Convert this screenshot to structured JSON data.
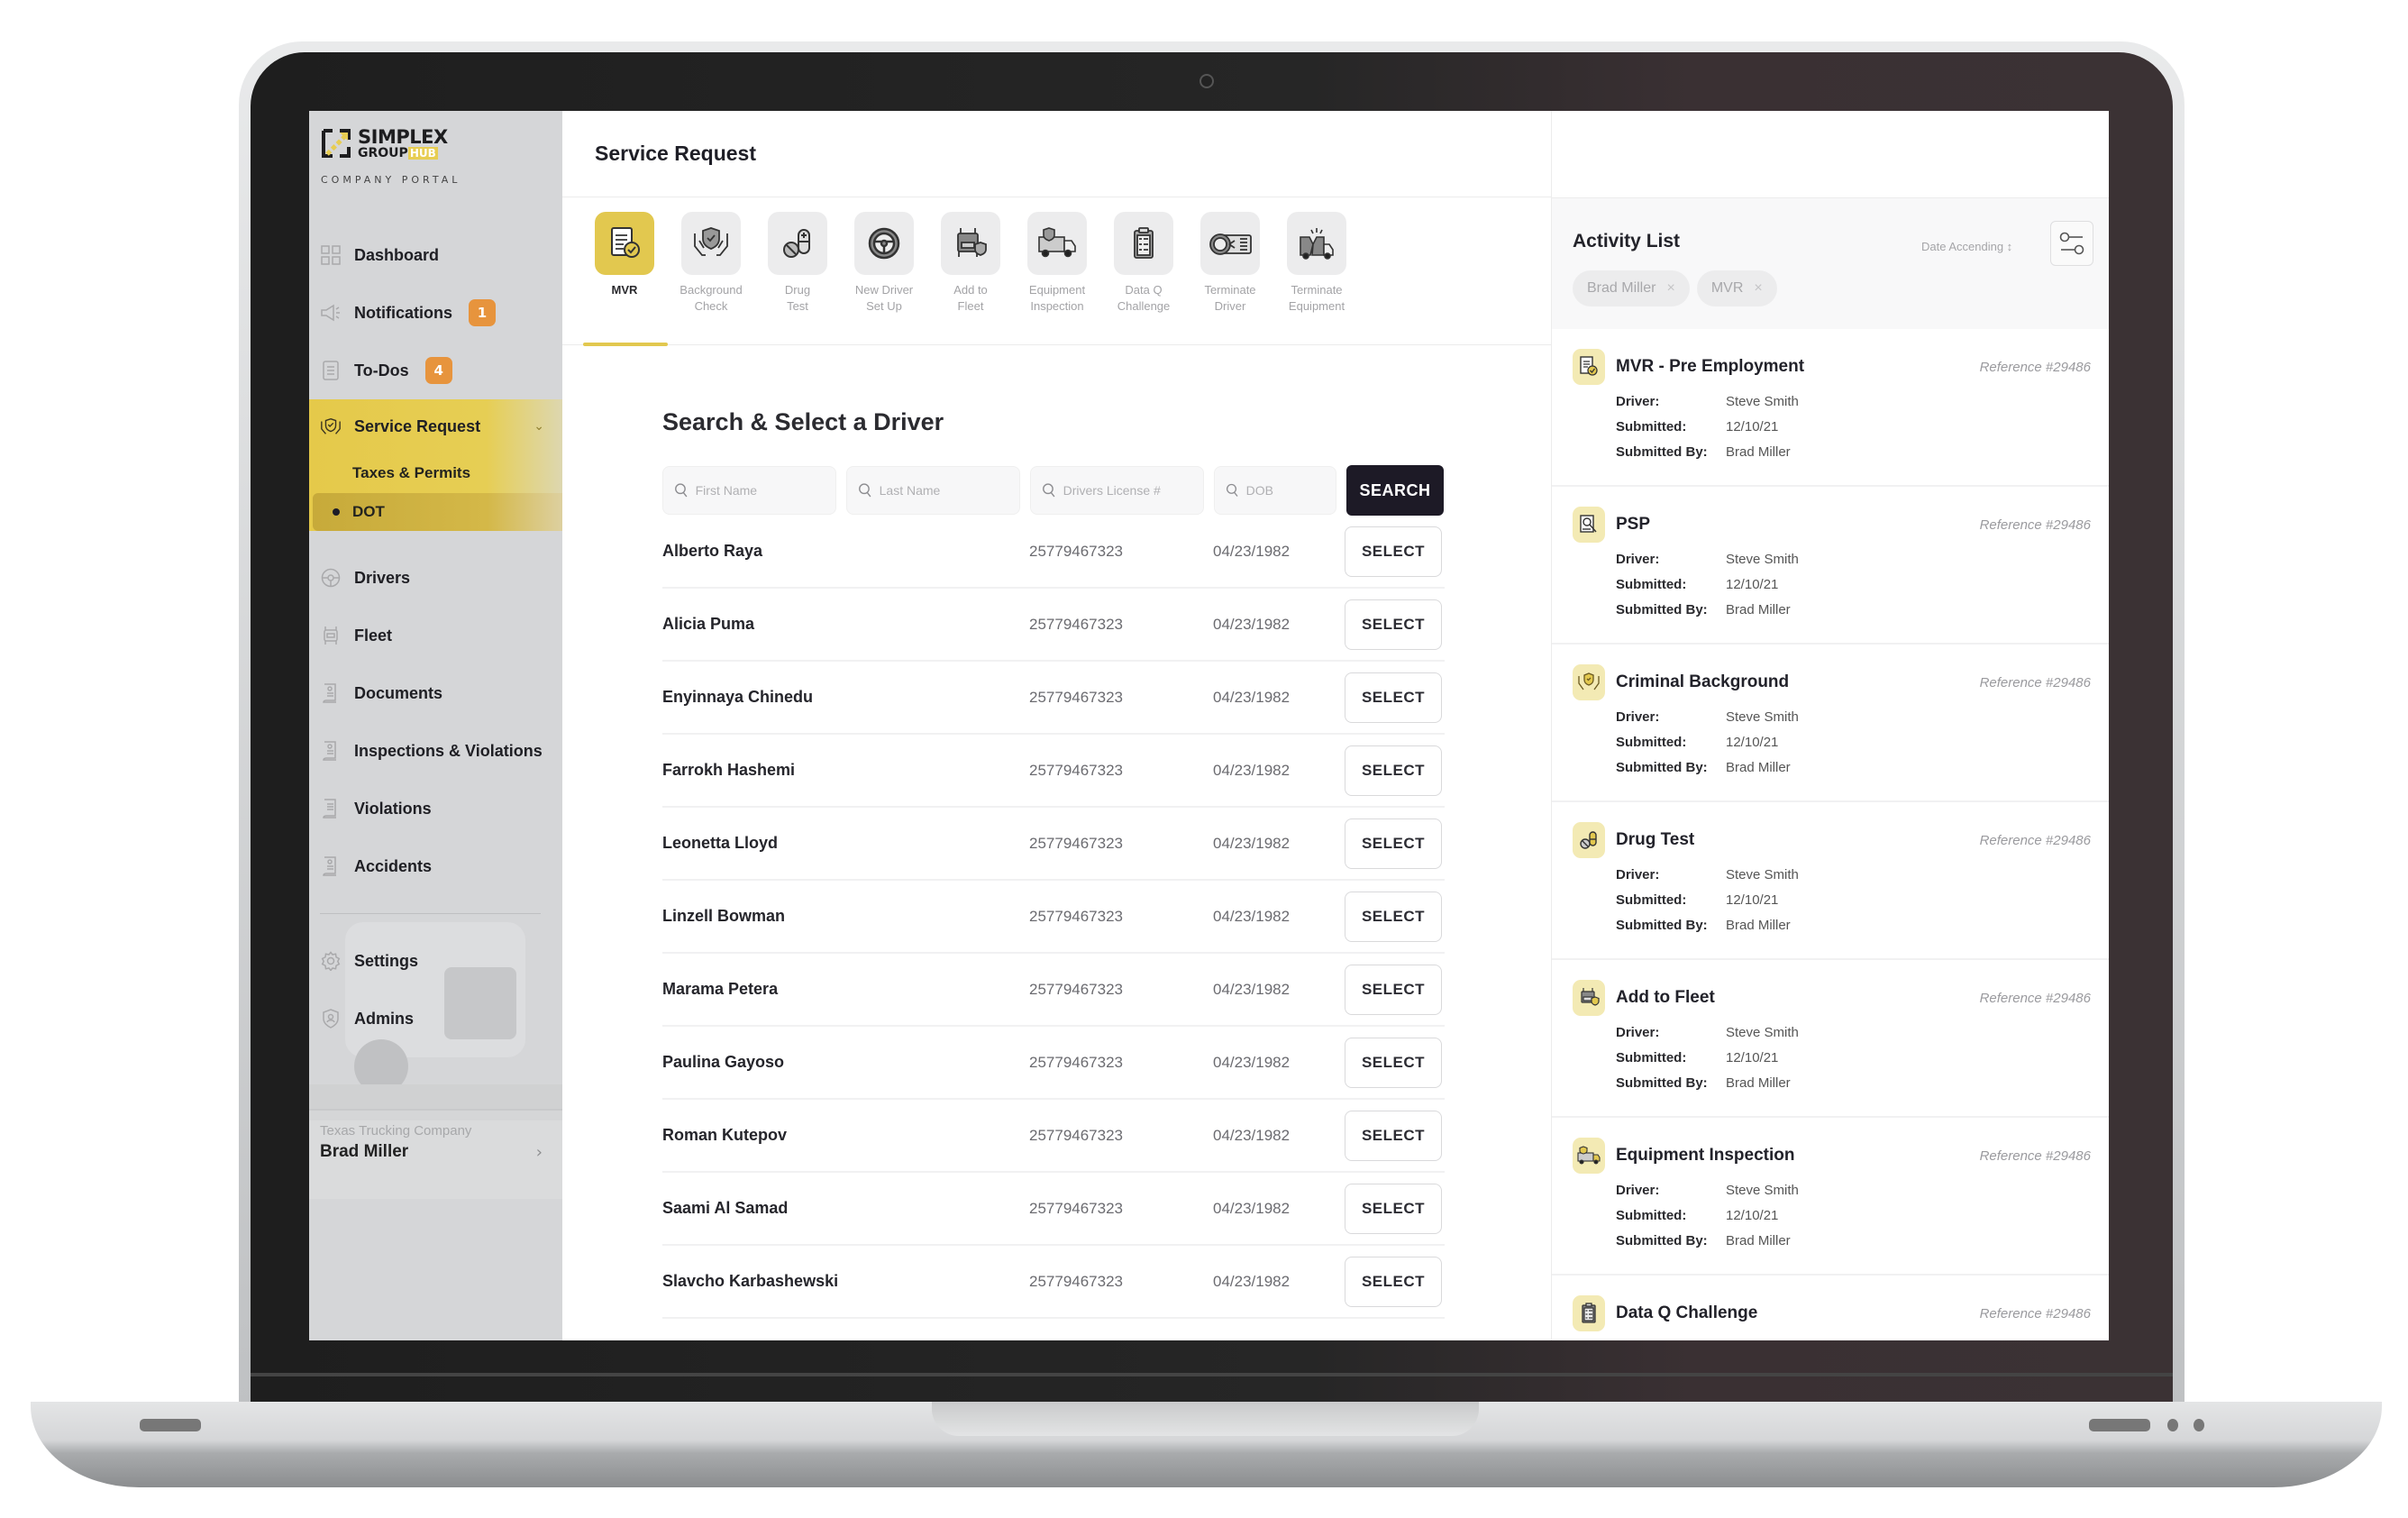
{
  "brand": {
    "name_line1": "SIMPLEX",
    "name_line2": "GROUP",
    "name_hub": "HUB",
    "subtitle": "COMPANY PORTAL"
  },
  "sidebar": {
    "items": [
      {
        "label": "Dashboard",
        "icon": "dashboard-grid-icon"
      },
      {
        "label": "Notifications",
        "icon": "megaphone-icon",
        "badge": "1"
      },
      {
        "label": "To-Dos",
        "icon": "clipboard-icon",
        "badge": "4"
      }
    ],
    "service_request": {
      "label": "Service Request",
      "icon": "hands-shield-icon",
      "expanded": true,
      "children": [
        {
          "label": "Taxes & Permits",
          "active": false
        },
        {
          "label": "DOT",
          "active": true
        }
      ]
    },
    "items2": [
      {
        "label": "Drivers",
        "icon": "steering-wheel-icon"
      },
      {
        "label": "Fleet",
        "icon": "truck-icon"
      },
      {
        "label": "Documents",
        "icon": "document-icon"
      },
      {
        "label": "Inspections & Violations",
        "icon": "document-icon"
      },
      {
        "label": "Violations",
        "icon": "document-icon"
      },
      {
        "label": "Accidents",
        "icon": "document-icon"
      }
    ],
    "items3": [
      {
        "label": "Settings",
        "icon": "gear-icon"
      },
      {
        "label": "Admins",
        "icon": "shield-user-icon"
      }
    ],
    "user": {
      "company": "Texas Trucking Company",
      "name": "Brad Miller"
    }
  },
  "header": {
    "title": "Service Request"
  },
  "service_tabs": [
    {
      "label": "MVR",
      "icon": "mvr-document-check-icon",
      "active": true
    },
    {
      "label": "Background\nCheck",
      "icon": "hands-shield-icon",
      "active": false
    },
    {
      "label": "Drug\nTest",
      "icon": "pill-icon",
      "active": false
    },
    {
      "label": "New Driver\nSet Up",
      "icon": "steering-wheel-icon",
      "active": false
    },
    {
      "label": "Add to\nFleet",
      "icon": "truck-shield-icon",
      "active": false
    },
    {
      "label": "Equipment\nInspection",
      "icon": "box-truck-shield-icon",
      "active": false
    },
    {
      "label": "Data Q\nChallenge",
      "icon": "clipboard-checklist-icon",
      "active": false
    },
    {
      "label": "Terminate\nDriver",
      "icon": "driver-card-icon",
      "active": false
    },
    {
      "label": "Terminate\nEquipment",
      "icon": "broken-truck-icon",
      "active": false
    }
  ],
  "search": {
    "title": "Search & Select a Driver",
    "first_name_placeholder": "First Name",
    "last_name_placeholder": "Last Name",
    "license_placeholder": "Drivers License #",
    "dob_placeholder": "DOB",
    "button_label": "SEARCH"
  },
  "drivers": [
    {
      "name": "Alberto Raya",
      "license": "25779467323",
      "dob": "04/23/1982",
      "action": "SELECT"
    },
    {
      "name": "Alicia Puma",
      "license": "25779467323",
      "dob": "04/23/1982",
      "action": "SELECT"
    },
    {
      "name": "Enyinnaya Chinedu",
      "license": "25779467323",
      "dob": "04/23/1982",
      "action": "SELECT"
    },
    {
      "name": "Farrokh Hashemi",
      "license": "25779467323",
      "dob": "04/23/1982",
      "action": "SELECT"
    },
    {
      "name": "Leonetta Lloyd",
      "license": "25779467323",
      "dob": "04/23/1982",
      "action": "SELECT"
    },
    {
      "name": "Linzell Bowman",
      "license": "25779467323",
      "dob": "04/23/1982",
      "action": "SELECT"
    },
    {
      "name": "Marama Petera",
      "license": "25779467323",
      "dob": "04/23/1982",
      "action": "SELECT"
    },
    {
      "name": "Paulina Gayoso",
      "license": "25779467323",
      "dob": "04/23/1982",
      "action": "SELECT"
    },
    {
      "name": "Roman Kutepov",
      "license": "25779467323",
      "dob": "04/23/1982",
      "action": "SELECT"
    },
    {
      "name": "Saami Al Samad",
      "license": "25779467323",
      "dob": "04/23/1982",
      "action": "SELECT"
    },
    {
      "name": "Slavcho Karbashewski",
      "license": "25779467323",
      "dob": "04/23/1982",
      "action": "SELECT"
    }
  ],
  "activity": {
    "title": "Activity List",
    "sort_label": "Date Accending ↕",
    "filters": [
      {
        "label": "Brad Miller"
      },
      {
        "label": "MVR"
      }
    ],
    "field_labels": {
      "driver": "Driver:",
      "submitted": "Submitted:",
      "submitted_by": "Submitted By:"
    },
    "items": [
      {
        "title": "MVR - Pre Employment",
        "icon": "mvr-document-check-icon",
        "reference": "Reference #29486",
        "driver": "Steve Smith",
        "submitted": "12/10/21",
        "submitted_by": "Brad Miller"
      },
      {
        "title": "PSP",
        "icon": "document-search-icon",
        "reference": "Reference #29486",
        "driver": "Steve Smith",
        "submitted": "12/10/21",
        "submitted_by": "Brad Miller"
      },
      {
        "title": "Criminal Background",
        "icon": "hands-shield-icon",
        "reference": "Reference #29486",
        "driver": "Steve Smith",
        "submitted": "12/10/21",
        "submitted_by": "Brad Miller"
      },
      {
        "title": "Drug Test",
        "icon": "pill-icon",
        "reference": "Reference #29486",
        "driver": "Steve Smith",
        "submitted": "12/10/21",
        "submitted_by": "Brad Miller"
      },
      {
        "title": "Add to Fleet",
        "icon": "truck-shield-icon",
        "reference": "Reference #29486",
        "driver": "Steve Smith",
        "submitted": "12/10/21",
        "submitted_by": "Brad Miller"
      },
      {
        "title": "Equipment Inspection",
        "icon": "box-truck-shield-icon",
        "reference": "Reference #29486",
        "driver": "Steve Smith",
        "submitted": "12/10/21",
        "submitted_by": "Brad Miller"
      },
      {
        "title": "Data Q Challenge",
        "icon": "clipboard-checklist-icon",
        "reference": "Reference #29486"
      }
    ]
  },
  "colors": {
    "accent": "#e2c84f",
    "badge": "#e7943d",
    "primary_button": "#1d1a26",
    "sidebar_bg": "#d5d6d8"
  }
}
